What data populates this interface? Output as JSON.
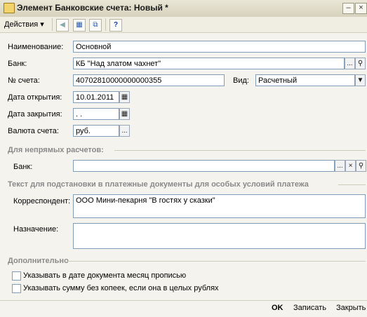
{
  "window": {
    "title": "Элемент Банковские счета: Новый *"
  },
  "toolbar": {
    "actions_label": "Действия ▾"
  },
  "form": {
    "name_label": "Наименование:",
    "name_value": "Основной",
    "bank_label": "Банк:",
    "bank_value": "КБ \"Над златом чахнет\"",
    "account_label": "№ счета:",
    "account_value": "40702810000000000355",
    "type_label": "Вид:",
    "type_value": "Расчетный",
    "open_date_label": "Дата открытия:",
    "open_date_value": "10.01.2011",
    "close_date_label": "Дата закрытия:",
    "close_date_value": "  .  .",
    "currency_label": "Валюта счета:",
    "currency_value": "руб."
  },
  "indirect": {
    "section_title": "Для непрямых расчетов:",
    "bank_label": "Банк:",
    "bank_value": ""
  },
  "payment_text": {
    "section_title": "Текст для подстановки в платежные документы для особых условий платежа",
    "correspondent_label": "Корреспондент:",
    "correspondent_value": "ООО Мини-пекарня \"В гостях у сказки\"",
    "purpose_label": "Назначение:",
    "purpose_value": ""
  },
  "extra": {
    "section_title": "Дополнительно",
    "checkbox1_label": "Указывать в дате документа месяц прописью",
    "checkbox2_label": "Указывать сумму без копеек, если она в целых рублях"
  },
  "buttons": {
    "ok": "OK",
    "save": "Записать",
    "close": "Закрыть"
  },
  "colors": {
    "field_border": "#7f9db9",
    "section_title": "#8a8a8a",
    "background": "#f4f3ee"
  }
}
